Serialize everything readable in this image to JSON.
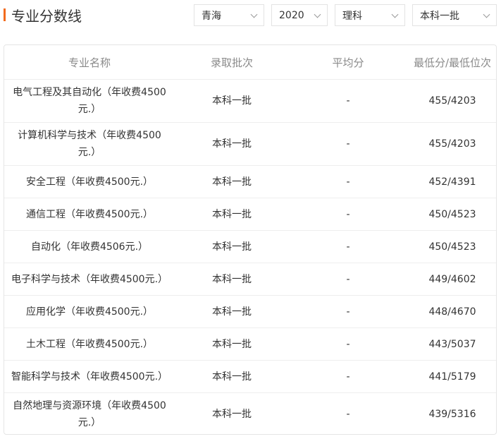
{
  "header": {
    "title": "专业分数线"
  },
  "filters": {
    "province": "青海",
    "year": "2020",
    "subject": "理科",
    "batch": "本科一批"
  },
  "table": {
    "columns": [
      "专业名称",
      "录取批次",
      "平均分",
      "最低分/最低位次"
    ],
    "rows": [
      {
        "name": "电气工程及其自动化（年收费4500元.）",
        "batch": "本科一批",
        "avg": "-",
        "min": "455/4203"
      },
      {
        "name": "计算机科学与技术（年收费4500元.）",
        "batch": "本科一批",
        "avg": "-",
        "min": "455/4203"
      },
      {
        "name": "安全工程（年收费4500元.）",
        "batch": "本科一批",
        "avg": "-",
        "min": "452/4391"
      },
      {
        "name": "通信工程（年收费4500元.）",
        "batch": "本科一批",
        "avg": "-",
        "min": "450/4523"
      },
      {
        "name": "自动化（年收费4506元.）",
        "batch": "本科一批",
        "avg": "-",
        "min": "450/4523"
      },
      {
        "name": "电子科学与技术（年收费4500元.）",
        "batch": "本科一批",
        "avg": "-",
        "min": "449/4602"
      },
      {
        "name": "应用化学（年收费4500元.）",
        "batch": "本科一批",
        "avg": "-",
        "min": "448/4670"
      },
      {
        "name": "土木工程（年收费4500元.）",
        "batch": "本科一批",
        "avg": "-",
        "min": "443/5037"
      },
      {
        "name": "智能科学与技术（年收费4500元.）",
        "batch": "本科一批",
        "avg": "-",
        "min": "441/5179"
      },
      {
        "name": "自然地理与资源环境（年收费4500元.）",
        "batch": "本科一批",
        "avg": "-",
        "min": "439/5316"
      }
    ]
  }
}
